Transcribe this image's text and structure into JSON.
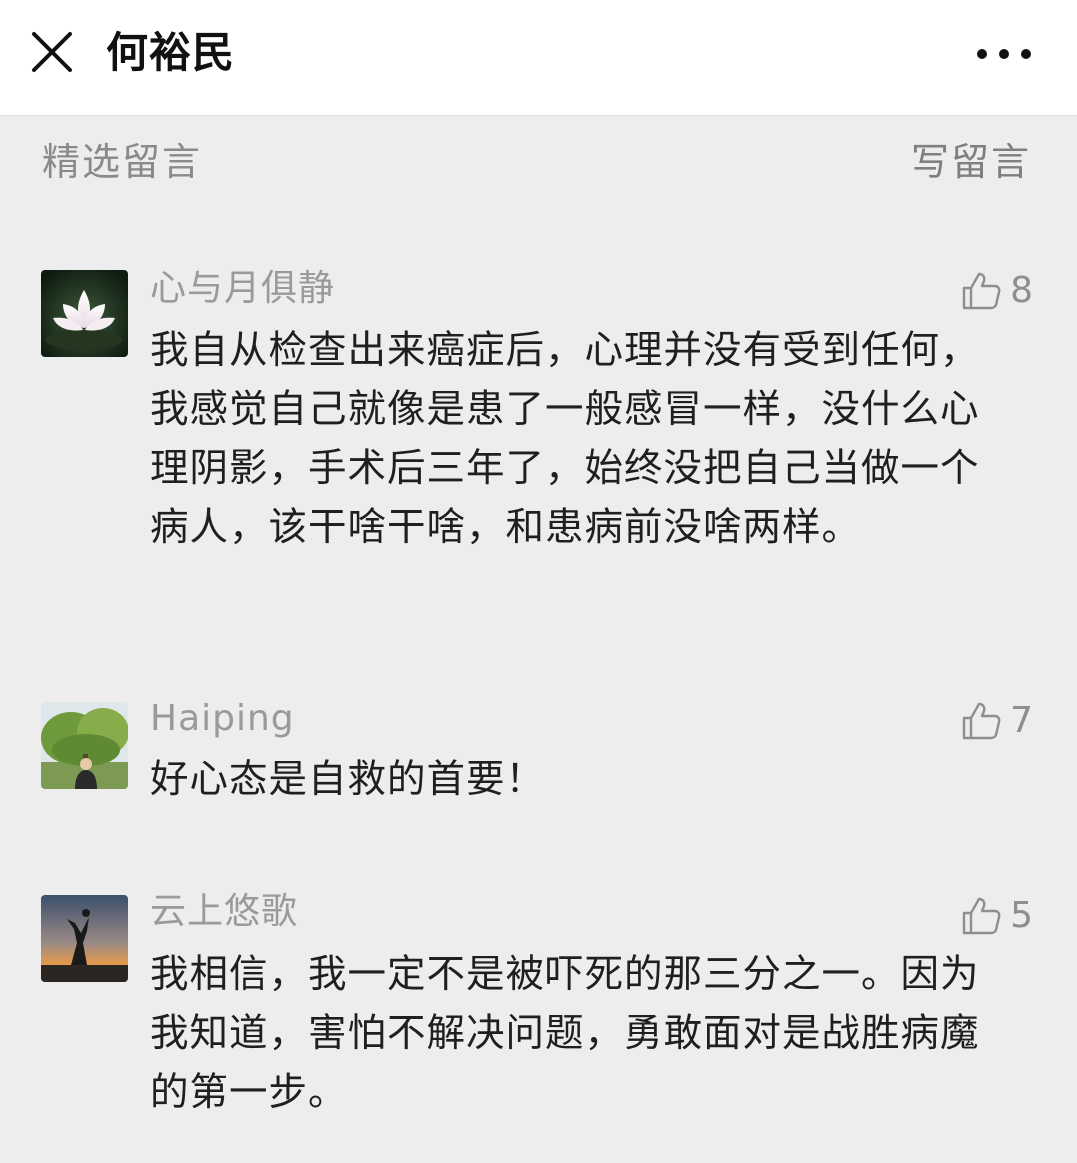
{
  "header": {
    "title": "何裕民",
    "close_icon": "close-icon",
    "more_icon": "more-dots-icon"
  },
  "section": {
    "title": "精选留言",
    "write_label": "写留言"
  },
  "comments": [
    {
      "nickname": "心与月俱静",
      "avatar": "lotus-avatar",
      "likes": "8",
      "text": "我自从检查出来癌症后，心理并没有受到任何，我感觉自己就像是患了一般感冒一样，没什么心理阴影，手术后三年了，始终没把自己当做一个病人，该干啥干啥，和患病前没啥两样。"
    },
    {
      "nickname": "Haiping",
      "avatar": "tree-person-avatar",
      "likes": "7",
      "text": "好心态是自救的首要！"
    },
    {
      "nickname": "云上悠歌",
      "avatar": "sunset-dancer-avatar",
      "likes": "5",
      "text": "我相信，我一定不是被吓死的那三分之一。因为我知道，害怕不解决问题，勇敢面对是战胜病魔的第一步。"
    }
  ],
  "colors": {
    "background": "#ededed",
    "header_bg": "#ffffff",
    "nickname": "#9a9a9a",
    "text": "#1f1f1f"
  }
}
